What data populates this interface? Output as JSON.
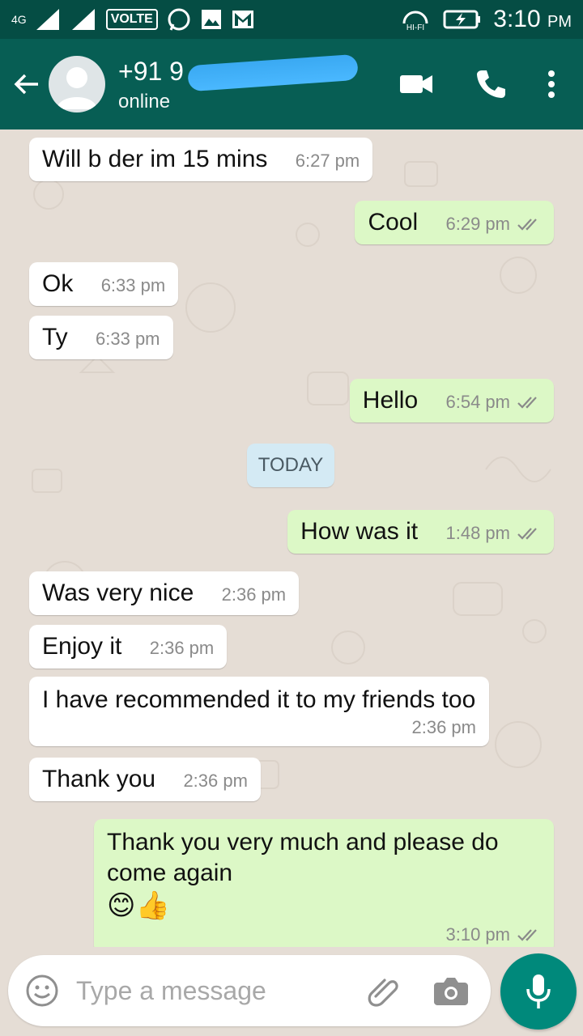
{
  "status_bar": {
    "network": "4G",
    "volte": "VOLTE",
    "hifi": "HI-FI",
    "time": "3:10",
    "ampm": "PM"
  },
  "header": {
    "contact_name": "+91 9",
    "contact_status": "online",
    "icons": [
      "back-arrow-icon",
      "video-call-icon",
      "phone-icon",
      "more-vert-icon"
    ]
  },
  "messages": [
    {
      "dir": "in",
      "text": "Will b der im 15 mins",
      "time": "6:27 pm"
    },
    {
      "dir": "out",
      "text": "Cool",
      "time": "6:29 pm"
    },
    {
      "dir": "in",
      "text": "Ok",
      "time": "6:33 pm"
    },
    {
      "dir": "in",
      "text": "Ty",
      "time": "6:33 pm"
    },
    {
      "dir": "out",
      "text": "Hello",
      "time": "6:54 pm"
    },
    {
      "dir": "out",
      "text": "How was it",
      "time": "1:48 pm"
    },
    {
      "dir": "in",
      "text": "Was very nice",
      "time": "2:36 pm"
    },
    {
      "dir": "in",
      "text": "Enjoy it",
      "time": "2:36 pm"
    },
    {
      "dir": "in",
      "text": "I have recommended it to my friends too",
      "time": "2:36 pm"
    },
    {
      "dir": "in",
      "text": "Thank you",
      "time": "2:36 pm"
    },
    {
      "dir": "out",
      "text": "Thank you very much and please do come again",
      "emoji": "😊👍",
      "time": "3:10 pm"
    }
  ],
  "date_divider": "TODAY",
  "composer": {
    "placeholder": "Type a message"
  },
  "colors": {
    "header": "#075e54",
    "status_bar": "#054d44",
    "outgoing_bubble": "#dcf8c6",
    "incoming_bubble": "#ffffff",
    "chat_background": "#e5ddd5",
    "mic_button": "#00897b"
  }
}
